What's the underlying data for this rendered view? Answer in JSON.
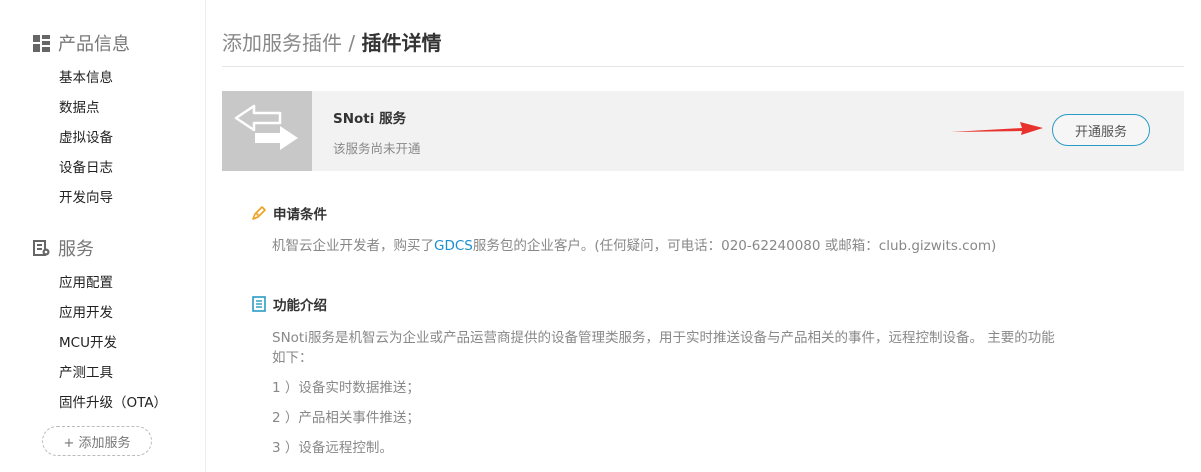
{
  "sidebar": {
    "product_section": {
      "title": "产品信息",
      "items": [
        "基本信息",
        "数据点",
        "虚拟设备",
        "设备日志",
        "开发向导"
      ]
    },
    "service_section": {
      "title": "服务",
      "items": [
        "应用配置",
        "应用开发",
        "MCU开发",
        "产测工具",
        "固件升级（OTA）"
      ]
    },
    "add_service_label": "+ 添加服务"
  },
  "breadcrumb": {
    "parent": "添加服务插件",
    "separator": " / ",
    "current": "插件详情"
  },
  "service_card": {
    "name": "SNoti 服务",
    "status": "该服务尚未开通",
    "open_button_label": "开通服务"
  },
  "requirements": {
    "title": "申请条件",
    "text_before": "机智云企业开发者，购买了",
    "link_text": "GDCS",
    "text_after": "服务包的企业客户。(任何疑问，可电话：020-62240080 或邮箱：club.gizwits.com)"
  },
  "features": {
    "title": "功能介绍",
    "line1": "SNoti服务是机智云为企业或产品运营商提供的设备管理类服务，用于实时推送设备与产品相关的事件，远程控制设备。 主要的功能",
    "line2": "如下：",
    "items": [
      "1 ）设备实时数据推送；",
      "2 ）产品相关事件推送；",
      "3 ）设备远程控制。"
    ]
  },
  "colors": {
    "accent_blue": "#2a9bc4",
    "link_blue": "#1a8fd1",
    "annotation_red": "#e8322d",
    "card_bg": "#f2f2f2",
    "thumb_bg": "#c8c8c8"
  }
}
